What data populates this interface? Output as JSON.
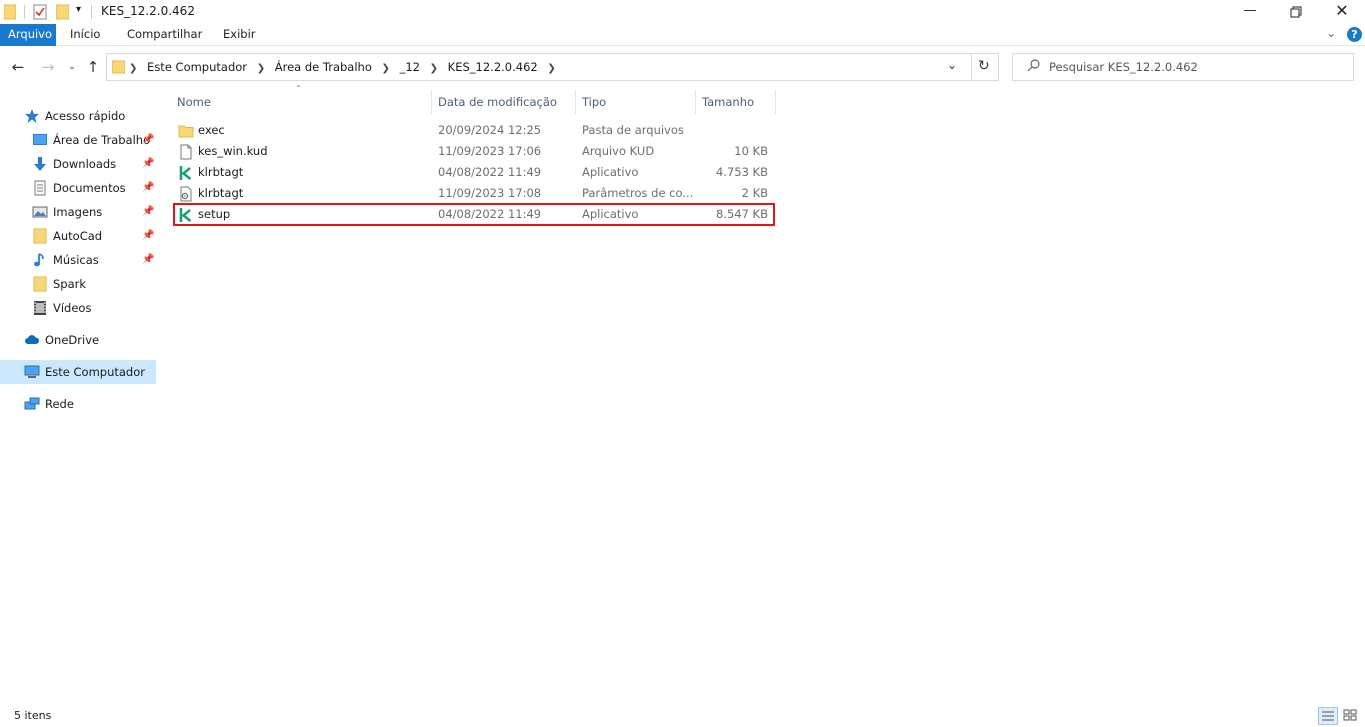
{
  "window": {
    "title": "KES_12.2.0.462"
  },
  "ribbon": {
    "tabs": [
      "Arquivo",
      "Início",
      "Compartilhar",
      "Exibir"
    ]
  },
  "address": {
    "crumbs": [
      "Este Computador",
      "Área de Trabalho",
      "_12",
      "KES_12.2.0.462"
    ]
  },
  "search": {
    "placeholder": "Pesquisar KES_12.2.0.462"
  },
  "sidebar": {
    "quick_access": "Acesso rápido",
    "items": [
      {
        "label": "Área de Trabalho",
        "icon": "desktop-icon",
        "pinned": true
      },
      {
        "label": "Downloads",
        "icon": "downloads-icon",
        "pinned": true
      },
      {
        "label": "Documentos",
        "icon": "documents-icon",
        "pinned": true
      },
      {
        "label": "Imagens",
        "icon": "pictures-icon",
        "pinned": true
      },
      {
        "label": "AutoCad",
        "icon": "folder-icon",
        "pinned": true
      },
      {
        "label": "Músicas",
        "icon": "music-icon",
        "pinned": true
      },
      {
        "label": "Spark",
        "icon": "folder-icon",
        "pinned": false
      },
      {
        "label": "Vídeos",
        "icon": "videos-icon",
        "pinned": false
      }
    ],
    "onedrive": "OneDrive",
    "this_pc": "Este Computador",
    "network": "Rede"
  },
  "columns": {
    "name": "Nome",
    "date": "Data de modificação",
    "type": "Tipo",
    "size": "Tamanho"
  },
  "files": [
    {
      "name": "exec",
      "date": "20/09/2024 12:25",
      "type": "Pasta de arquivos",
      "size": "",
      "icon": "folder-icon"
    },
    {
      "name": "kes_win.kud",
      "date": "11/09/2023 17:06",
      "type": "Arquivo KUD",
      "size": "10 KB",
      "icon": "file-icon"
    },
    {
      "name": "klrbtagt",
      "date": "04/08/2022 11:49",
      "type": "Aplicativo",
      "size": "4.753 KB",
      "icon": "kaspersky-icon"
    },
    {
      "name": "klrbtagt",
      "date": "11/09/2023 17:08",
      "type": "Parâmetros de co...",
      "size": "2 KB",
      "icon": "settings-file-icon"
    },
    {
      "name": "setup",
      "date": "04/08/2022 11:49",
      "type": "Aplicativo",
      "size": "8.547 KB",
      "icon": "kaspersky-icon"
    }
  ],
  "status": {
    "count": "5 itens"
  },
  "colors": {
    "accent": "#1979ca",
    "highlight": "#e1141c",
    "selected": "#cce8ff",
    "kaspersky": "#1e9e73",
    "folder": "#f8d775"
  }
}
